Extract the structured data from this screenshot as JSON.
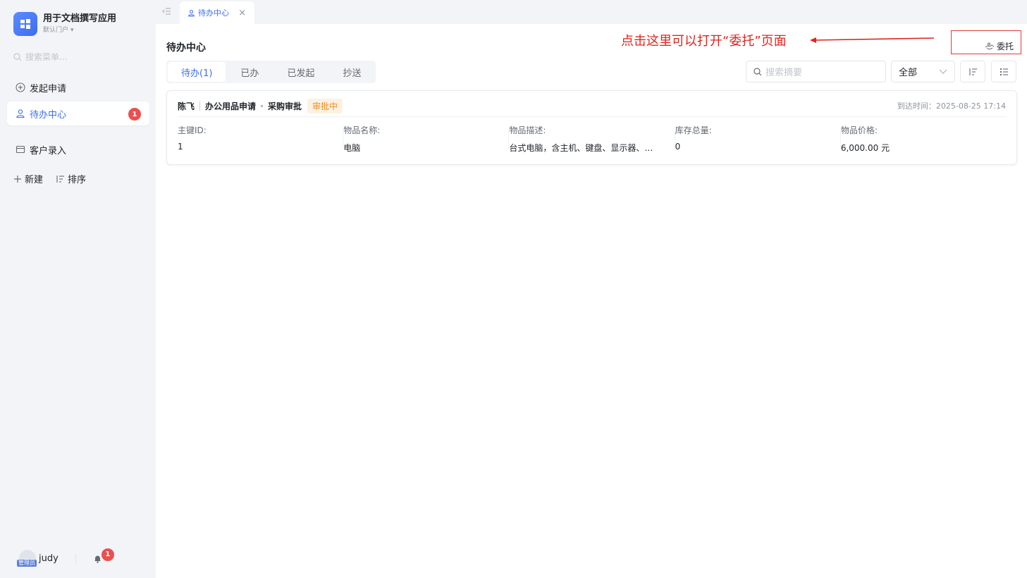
{
  "app": {
    "name": "用于文档撰写应用",
    "portal": "默认门户"
  },
  "sidebar": {
    "search_placeholder": "搜索菜单...",
    "items": [
      {
        "label": "发起申请",
        "icon": "plus-circle-icon"
      },
      {
        "label": "待办中心",
        "icon": "user-task-icon",
        "badge": "1",
        "active": true
      },
      {
        "label": "客户录入",
        "icon": "card-icon"
      }
    ],
    "new_label": "新建",
    "sort_label": "排序",
    "user": {
      "name": "judy",
      "role": "管理员"
    },
    "notification_count": "1"
  },
  "tabbar": {
    "tab_label": "待办中心"
  },
  "page": {
    "title": "待办中心",
    "annotation": "点击这里可以打开“委托”页面",
    "delegate_label": "委托",
    "tabs": [
      "待办(1)",
      "已办",
      "已发起",
      "抄送"
    ],
    "search_placeholder": "搜索摘要",
    "filter_value": "全部"
  },
  "card": {
    "applicant": "陈飞",
    "process": "办公用品申请",
    "node": "采购审批",
    "status": "审批中",
    "arrival": "到达时间：2025-08-25 17:14",
    "fields": [
      {
        "label": "主键ID:",
        "value": "1"
      },
      {
        "label": "物品名称:",
        "value": "电脑"
      },
      {
        "label": "物品描述:",
        "value": "台式电脑，含主机、键盘、显示器、…"
      },
      {
        "label": "库存总量:",
        "value": "0"
      },
      {
        "label": "物品价格:",
        "value": "6,000.00 元"
      }
    ]
  },
  "colors": {
    "accent": "#3b6ef5",
    "annotation": "#e0241d",
    "badge": "#e9504f",
    "status": "#f08c1f"
  }
}
